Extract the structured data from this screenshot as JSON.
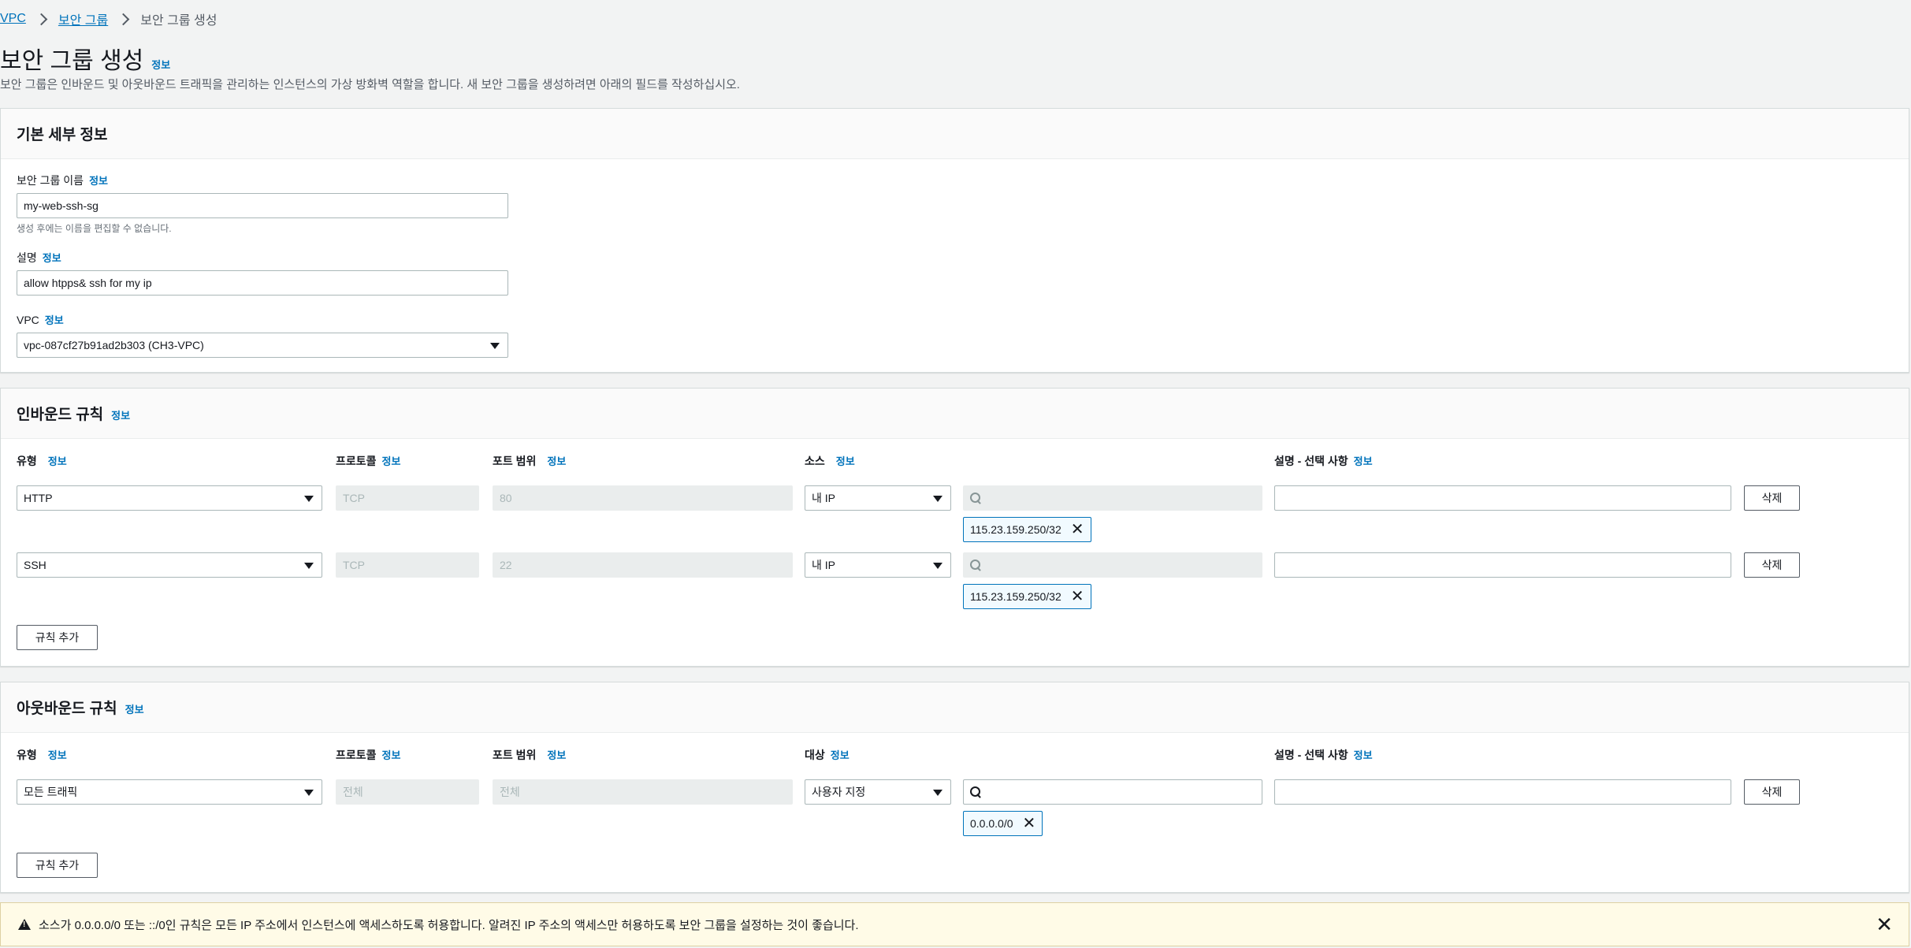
{
  "breadcrumb": {
    "vpc": "VPC",
    "security_groups": "보안 그룹",
    "current": "보안 그룹 생성"
  },
  "page": {
    "title": "보안 그룹 생성",
    "info": "정보",
    "description": "보안 그룹은 인바운드 및 아웃바운드 트래픽을 관리하는 인스턴스의 가상 방화벽 역할을 합니다. 새 보안 그룹을 생성하려면 아래의 필드를 작성하십시오."
  },
  "basic": {
    "title": "기본 세부 정보",
    "name_label": "보안 그룹 이름",
    "name_info": "정보",
    "name_value": "my-web-ssh-sg",
    "name_hint": "생성 후에는 이름을 편집할 수 없습니다.",
    "desc_label": "설명",
    "desc_info": "정보",
    "desc_value": "allow htpps& ssh for my ip",
    "vpc_label": "VPC",
    "vpc_info": "정보",
    "vpc_value": "vpc-087cf27b91ad2b303 (CH3-VPC)"
  },
  "inbound": {
    "title": "인바운드 규칙",
    "title_info": "정보",
    "columns": {
      "type": "유형",
      "type_info": "정보",
      "protocol": "프로토콜",
      "protocol_info": "정보",
      "port": "포트 범위",
      "port_info": "정보",
      "source": "소스",
      "source_info": "정보",
      "desc": "설명 - 선택 사항",
      "desc_info": "정보"
    },
    "rules": [
      {
        "type": "HTTP",
        "protocol": "TCP",
        "port": "80",
        "source": "내 IP",
        "token": "115.23.159.250/32",
        "delete": "삭제"
      },
      {
        "type": "SSH",
        "protocol": "TCP",
        "port": "22",
        "source": "내 IP",
        "token": "115.23.159.250/32",
        "delete": "삭제"
      }
    ],
    "add_rule": "규칙 추가"
  },
  "outbound": {
    "title": "아웃바운드 규칙",
    "title_info": "정보",
    "columns": {
      "type": "유형",
      "type_info": "정보",
      "protocol": "프로토콜",
      "protocol_info": "정보",
      "port": "포트 범위",
      "port_info": "정보",
      "dest": "대상",
      "dest_info": "정보",
      "desc": "설명 - 선택 사항",
      "desc_info": "정보"
    },
    "rules": [
      {
        "type": "모든 트래픽",
        "protocol": "전체",
        "port": "전체",
        "dest": "사용자 지정",
        "token": "0.0.0.0/0",
        "delete": "삭제"
      }
    ],
    "add_rule": "규칙 추가"
  },
  "warning": {
    "text": "소스가 0.0.0.0/0 또는 ::/0인 규칙은 모든 IP 주소에서 인스턴스에 액세스하도록 허용합니다. 알려진 IP 주소의 액세스만 허용하도록 보안 그룹을 설정하는 것이 좋습니다."
  },
  "colors": {
    "link": "#0073bb",
    "token_border": "#0073bb",
    "token_bg": "#f1faff",
    "warning_bg": "#fffbe7"
  }
}
